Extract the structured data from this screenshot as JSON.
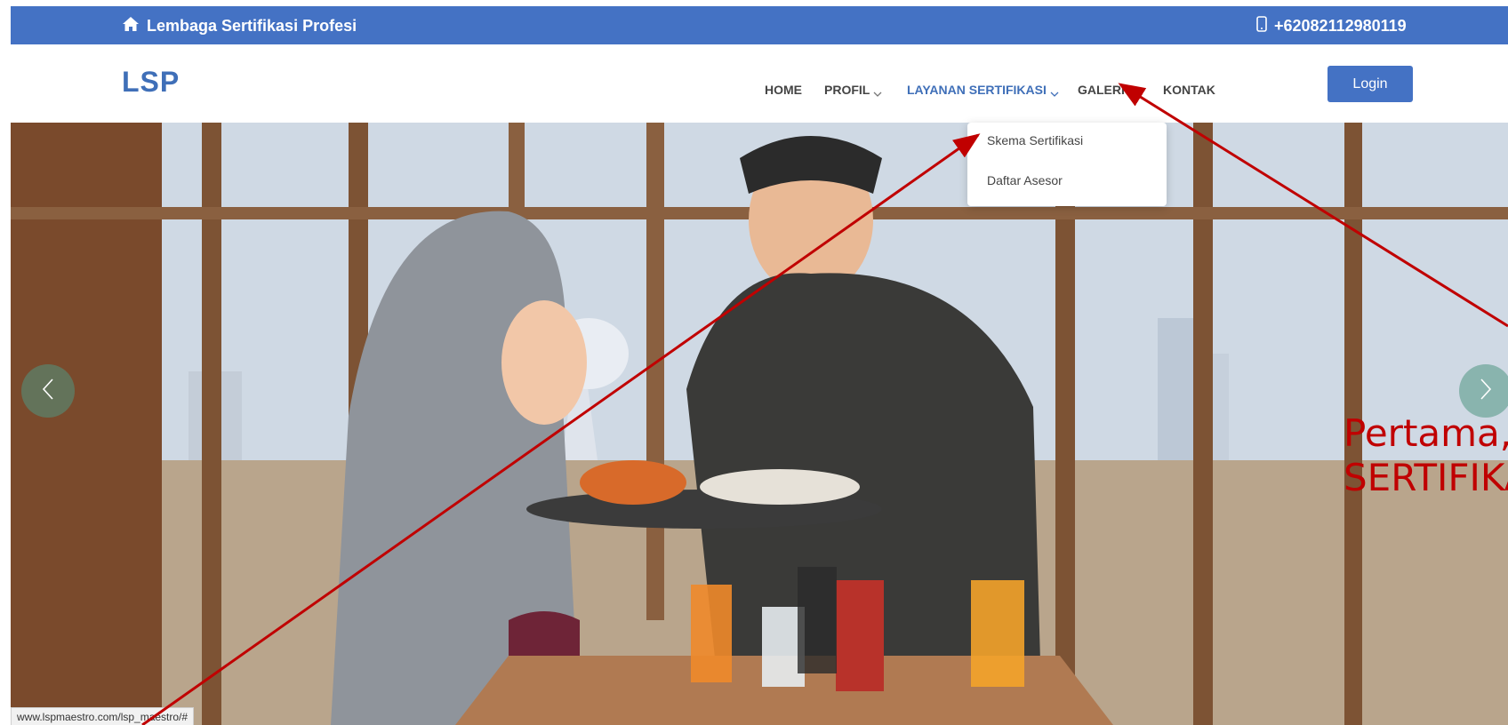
{
  "topbar": {
    "brand_icon": "home-icon",
    "brand": "Lembaga Sertifikasi Profesi",
    "phone_icon": "mobile-phone-icon",
    "phone": "+62082112980119"
  },
  "navbar": {
    "logo": "LSP",
    "menu": {
      "home": "HOME",
      "profil": "PROFIL",
      "layanan": "LAYANAN SERTIFIKASI",
      "galeri": "GALERI",
      "kontak": "KONTAK"
    },
    "login": "Login"
  },
  "dropdown": {
    "items": [
      "Skema Sertifikasi",
      "Daftar Asesor"
    ]
  },
  "annotation": {
    "text": "Pertama,k\nSERTIFIKA"
  },
  "status_bar": {
    "url": "www.lspmaestro.com/lsp_maestro/#"
  },
  "colors": {
    "brand_blue": "#4472c4",
    "link_blue": "#3f6fb8",
    "annotation_red": "#c00000"
  }
}
